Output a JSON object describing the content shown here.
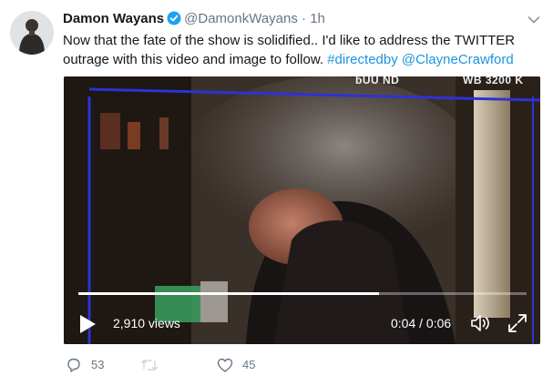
{
  "tweet": {
    "author_name": "Damon Wayans",
    "handle": "@DamonkWayans",
    "separator": "·",
    "time": "1h",
    "text_plain": "Now that the fate of the show is solidified.. I'd like to address the TWITTER outrage with this video and image to follow. ",
    "hashtag": "#directedby",
    "mention": "@ClayneCrawford"
  },
  "video": {
    "views": "2,910 views",
    "timecode": "0:04 / 0:06",
    "progress": 0.67,
    "overlay_left": "ƃUU   ND",
    "overlay_right": "WB   3200 K"
  },
  "actions": {
    "reply_count": "53",
    "retweet_count": "",
    "like_count": "45"
  },
  "colors": {
    "link": "#1b95e0",
    "verified": "#1da1f2",
    "muted": "#657786",
    "frame_lines": "#2c33d6"
  }
}
